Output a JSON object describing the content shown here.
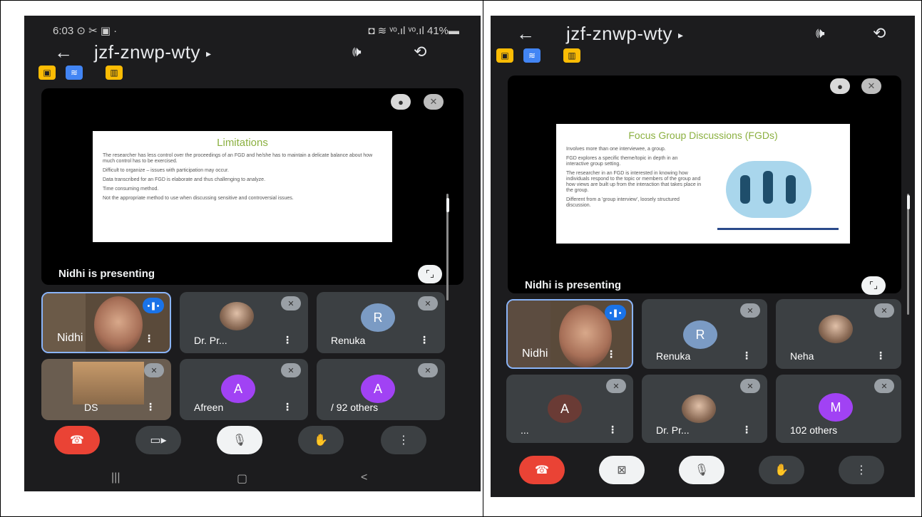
{
  "left": {
    "status": {
      "time": "6:03",
      "left_icons": "⊙ ✂ ▣ ·",
      "right_icons": "◘ ≋ ᵛᵒ.ıl ᵛᵒ.ıl 41%▬"
    },
    "meeting_code": "jzf-znwp-wty",
    "title_arrow": "▸",
    "slide": {
      "title": "Limitations",
      "lines": [
        "The researcher has less control over the proceedings of an FGD and he/she has to maintain a delicate balance about how much control has to be exercised.",
        "Difficult to organize – issues with participation may occur.",
        "Data transcribed for an FGD is elaborate and thus challenging to analyze.",
        "Time consuming method.",
        "Not the appropriate method to use when discussing sensitive and controversial issues."
      ]
    },
    "presenting_label": "Nidhi is presenting",
    "tiles": [
      {
        "name": "Nidhi"
      },
      {
        "name": "Dr. Pr..."
      },
      {
        "name": "Renuka",
        "initial": "R"
      },
      {
        "name": "DS"
      },
      {
        "name": "Afreen",
        "initial": "A"
      },
      {
        "name": "92 others",
        "initial": "A",
        "prefix": "/"
      }
    ],
    "nav": {
      "recents": "|||",
      "home": "▢",
      "back": "<"
    }
  },
  "right": {
    "meeting_code": "jzf-znwp-wty",
    "title_arrow": "▸",
    "slide": {
      "title": "Focus Group Discussions (FGDs)",
      "lines": [
        "Involves more than one interviewee, a group.",
        "FGD explores a specific theme/topic in depth in an interactive group setting.",
        "The researcher in an FGD is interested in knowing how individuals respond to the topic or members of the group and how views are built up from the interaction that takes place in the group.",
        "Different from a 'group interview', loosely structured discussion."
      ]
    },
    "presenting_label": "Nidhi is presenting",
    "tiles": [
      {
        "name": "Nidhi"
      },
      {
        "name": "Renuka",
        "initial": "R"
      },
      {
        "name": "Neha"
      },
      {
        "name": "...",
        "initial": "A"
      },
      {
        "name": "Dr. Pr..."
      },
      {
        "name": "102 others",
        "initial": "M"
      }
    ]
  },
  "icons": {
    "back": "←",
    "speaker": "🕪",
    "switch_camera": "⟲",
    "pin": "📌",
    "mic_off": "🎙",
    "fullscreen": "⛶",
    "end_call": "☎",
    "camera": "▭▸",
    "camera_off": "⊠",
    "hand": "✋",
    "more": "⋮",
    "speaking": "•❚•"
  },
  "colors": {
    "end_call": "#ea4335",
    "accent": "#1a73e8",
    "slide_title": "#8bb040",
    "purple_avatar": "#a142f4"
  }
}
